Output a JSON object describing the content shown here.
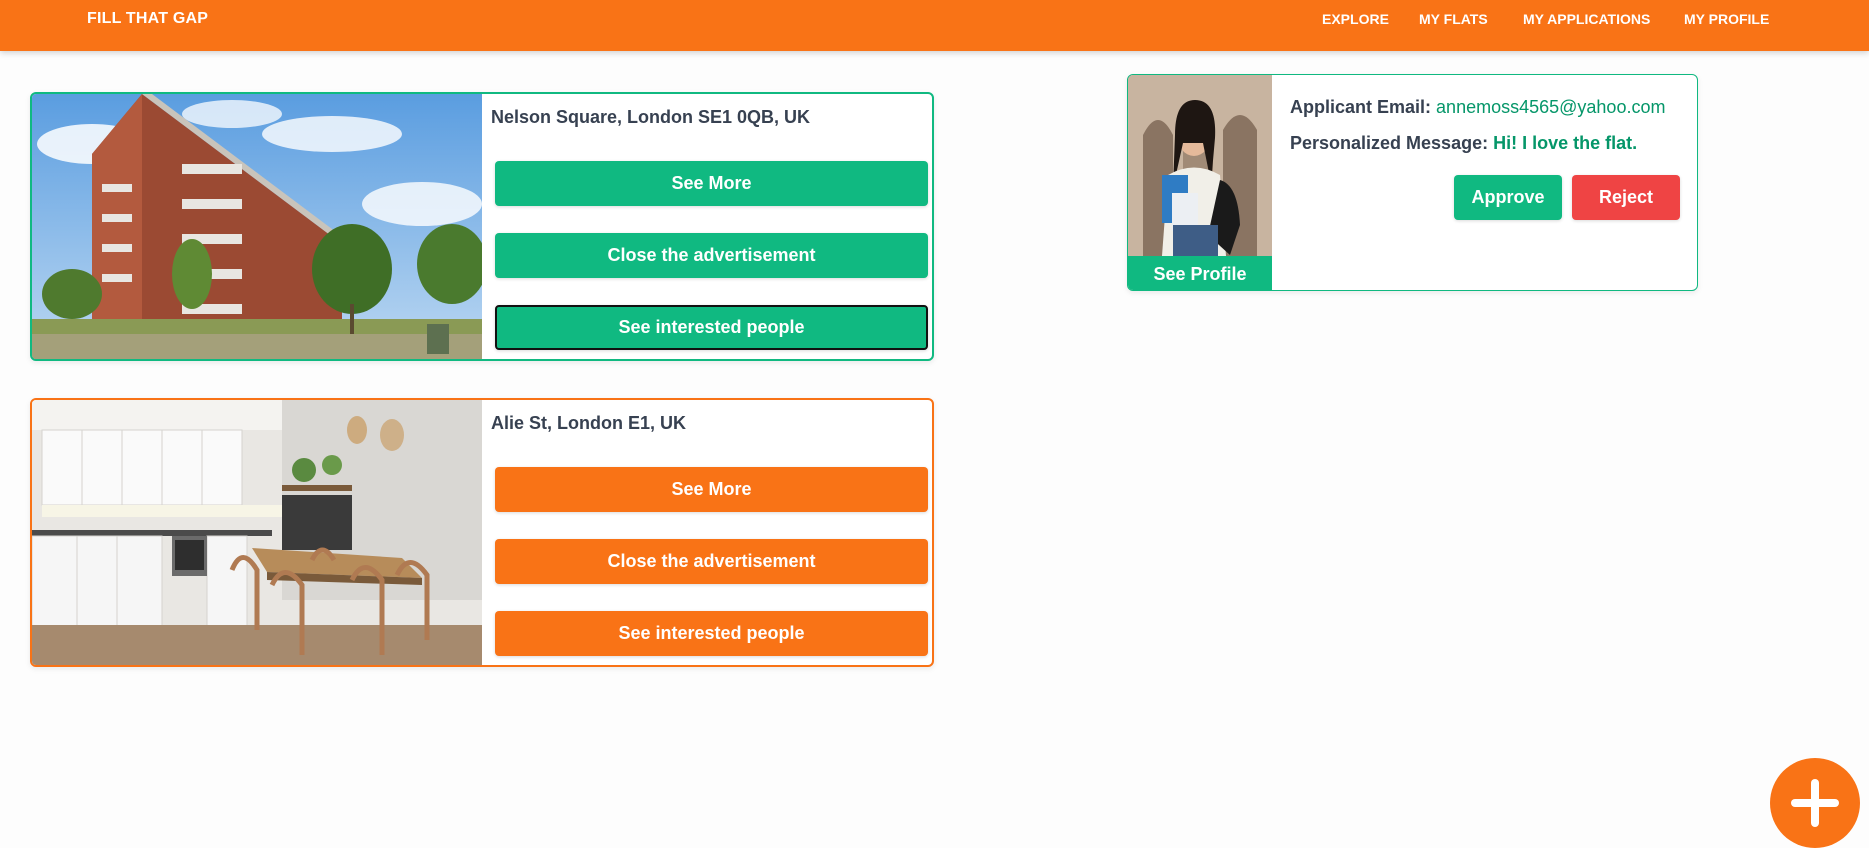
{
  "navbar": {
    "brand": "FILL THAT GAP",
    "links": [
      "EXPLORE",
      "MY FLATS",
      "MY APPLICATIONS",
      "MY PROFILE"
    ]
  },
  "flats": [
    {
      "address": "Nelson Square, London SE1 0QB, UK",
      "photo": "apartment-building-photo",
      "buttons": [
        "See More",
        "Close the advertisement",
        "See interested people"
      ]
    },
    {
      "address": "Alie St, London E1, UK",
      "photo": "kitchen-interior-photo",
      "buttons": [
        "See More",
        "Close the advertisement",
        "See interested people"
      ]
    }
  ],
  "applicant": {
    "photo": "applicant-photo",
    "see_profile_label": "See Profile",
    "email_label": "Applicant Email:",
    "email": "annemoss4565@yahoo.com",
    "message_label": "Personalized Message:",
    "message": "Hi! I love the flat.",
    "approve_label": "Approve",
    "reject_label": "Reject"
  },
  "fab": {
    "icon": "plus-icon"
  },
  "colors": {
    "brand_orange": "#f97316",
    "accent_green": "#10b981",
    "reject_red": "#ef4444",
    "text_dark": "#374151"
  }
}
